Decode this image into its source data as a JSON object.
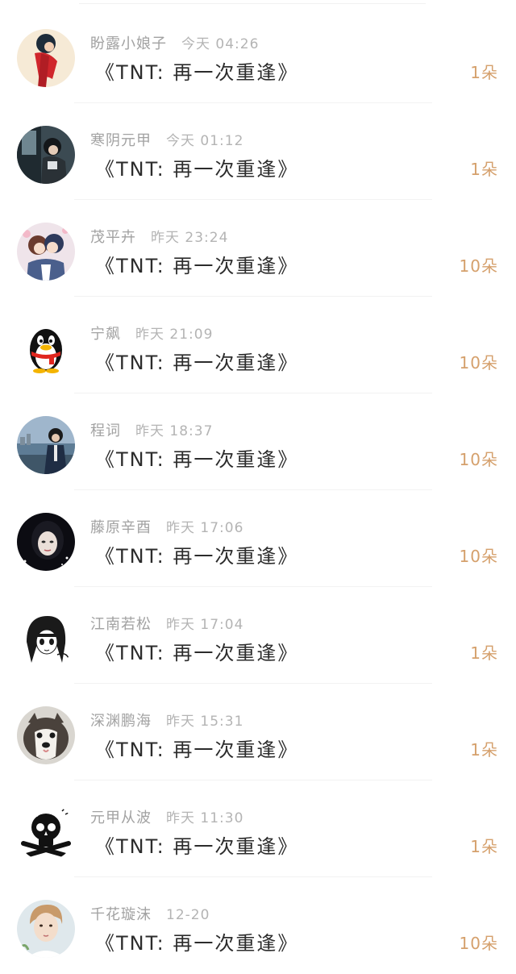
{
  "colors": {
    "background": "#ffffff",
    "name_text": "#a2a2a2",
    "title_text": "#2c2c2c",
    "count_text": "#d5a06c",
    "divider": "#f2f2f2"
  },
  "rows": [
    {
      "name": "盼露小娘子",
      "time": "今天 04:26",
      "title": "《TNT: 再一次重逢》",
      "count": "1朵",
      "avatar_icon": "girl-red-dress-avatar-icon"
    },
    {
      "name": "寒阴元甲",
      "time": "今天 01:12",
      "title": "《TNT: 再一次重逢》",
      "count": "1朵",
      "avatar_icon": "girl-window-avatar-icon"
    },
    {
      "name": "茂平卉",
      "time": "昨天 23:24",
      "title": "《TNT: 再一次重逢》",
      "count": "10朵",
      "avatar_icon": "anime-couple-avatar-icon"
    },
    {
      "name": "宁飙",
      "time": "昨天 21:09",
      "title": "《TNT: 再一次重逢》",
      "count": "10朵",
      "avatar_icon": "penguin-avatar-icon"
    },
    {
      "name": "程词",
      "time": "昨天 18:37",
      "title": "《TNT: 再一次重逢》",
      "count": "10朵",
      "avatar_icon": "man-waterfront-avatar-icon"
    },
    {
      "name": "藤原辛酉",
      "time": "昨天 17:06",
      "title": "《TNT: 再一次重逢》",
      "count": "10朵",
      "avatar_icon": "girl-night-avatar-icon"
    },
    {
      "name": "江南若松",
      "time": "昨天 17:04",
      "title": "《TNT: 再一次重逢》",
      "count": "1朵",
      "avatar_icon": "manga-girl-avatar-icon"
    },
    {
      "name": "深渊鹏海",
      "time": "昨天 15:31",
      "title": "《TNT: 再一次重逢》",
      "count": "1朵",
      "avatar_icon": "husky-puppy-avatar-icon"
    },
    {
      "name": "元甲从波",
      "time": "昨天 11:30",
      "title": "《TNT: 再一次重逢》",
      "count": "1朵",
      "avatar_icon": "skull-crossbones-avatar-icon"
    },
    {
      "name": "千花璇沫",
      "time": "12-20",
      "title": "《TNT: 再一次重逢》",
      "count": "10朵",
      "avatar_icon": "boy-portrait-avatar-icon"
    }
  ]
}
